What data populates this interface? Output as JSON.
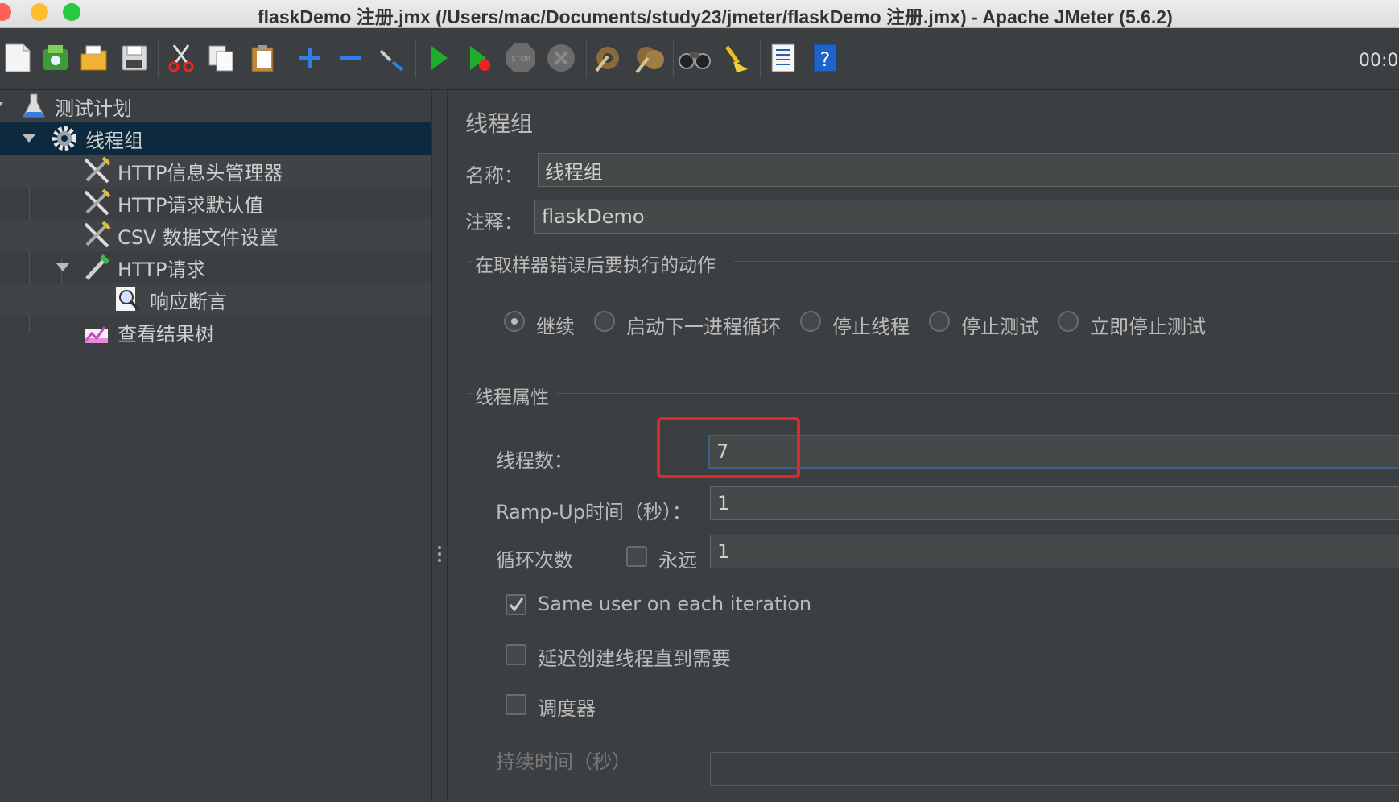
{
  "window": {
    "title": "flaskDemo 注册.jmx (/Users/mac/Documents/study23/jmeter/flaskDemo 注册.jmx) - Apache JMeter (5.6.2)"
  },
  "toolbar": {
    "timer": "00:0",
    "icons": [
      "new-icon",
      "templates-icon",
      "open-icon",
      "save-icon",
      "cut-icon",
      "copy-icon",
      "paste-icon",
      "expand-icon",
      "collapse-icon",
      "toggle-icon",
      "start-icon",
      "start-no-timers-icon",
      "stop-icon",
      "shutdown-icon",
      "clear-icon",
      "clear-all-icon",
      "search-icon",
      "reset-search-icon",
      "function-helper-icon",
      "help-icon"
    ]
  },
  "tree": {
    "items": [
      {
        "label": "测试计划",
        "icon": "test-plan-icon"
      },
      {
        "label": "线程组",
        "icon": "thread-group-gear-icon"
      },
      {
        "label": "HTTP信息头管理器",
        "icon": "config-tools-icon"
      },
      {
        "label": "HTTP请求默认值",
        "icon": "config-tools-icon"
      },
      {
        "label": "CSV 数据文件设置",
        "icon": "config-tools-icon"
      },
      {
        "label": "HTTP请求",
        "icon": "sampler-pipette-icon"
      },
      {
        "label": "响应断言",
        "icon": "assertion-magnifier-icon"
      },
      {
        "label": "查看结果树",
        "icon": "listener-chart-icon"
      }
    ]
  },
  "panel": {
    "title": "线程组",
    "name_label": "名称：",
    "name_value": "线程组",
    "comment_label": "注释：",
    "comment_value": "flaskDemo",
    "error_section": "在取样器错误后要执行的动作",
    "error_options": [
      "继续",
      "启动下一进程循环",
      "停止线程",
      "停止测试",
      "立即停止测试"
    ],
    "error_selected": "继续",
    "thread_section": "线程属性",
    "threads_label": "线程数：",
    "threads_value": "7",
    "rampup_label": "Ramp-Up时间（秒）：",
    "rampup_value": "1",
    "loop_label": "循环次数",
    "forever_label": "永远",
    "loop_value": "1",
    "same_user_label": "Same user on each iteration",
    "same_user_checked": true,
    "delay_label": "延迟创建线程直到需要",
    "scheduler_label": "调度器",
    "duration_label": "持续时间（秒）"
  },
  "colors": {
    "background": "#3c3f41",
    "selection": "#0d293e",
    "highlight_box": "#e0282a",
    "focus_border": "#3d6185"
  }
}
